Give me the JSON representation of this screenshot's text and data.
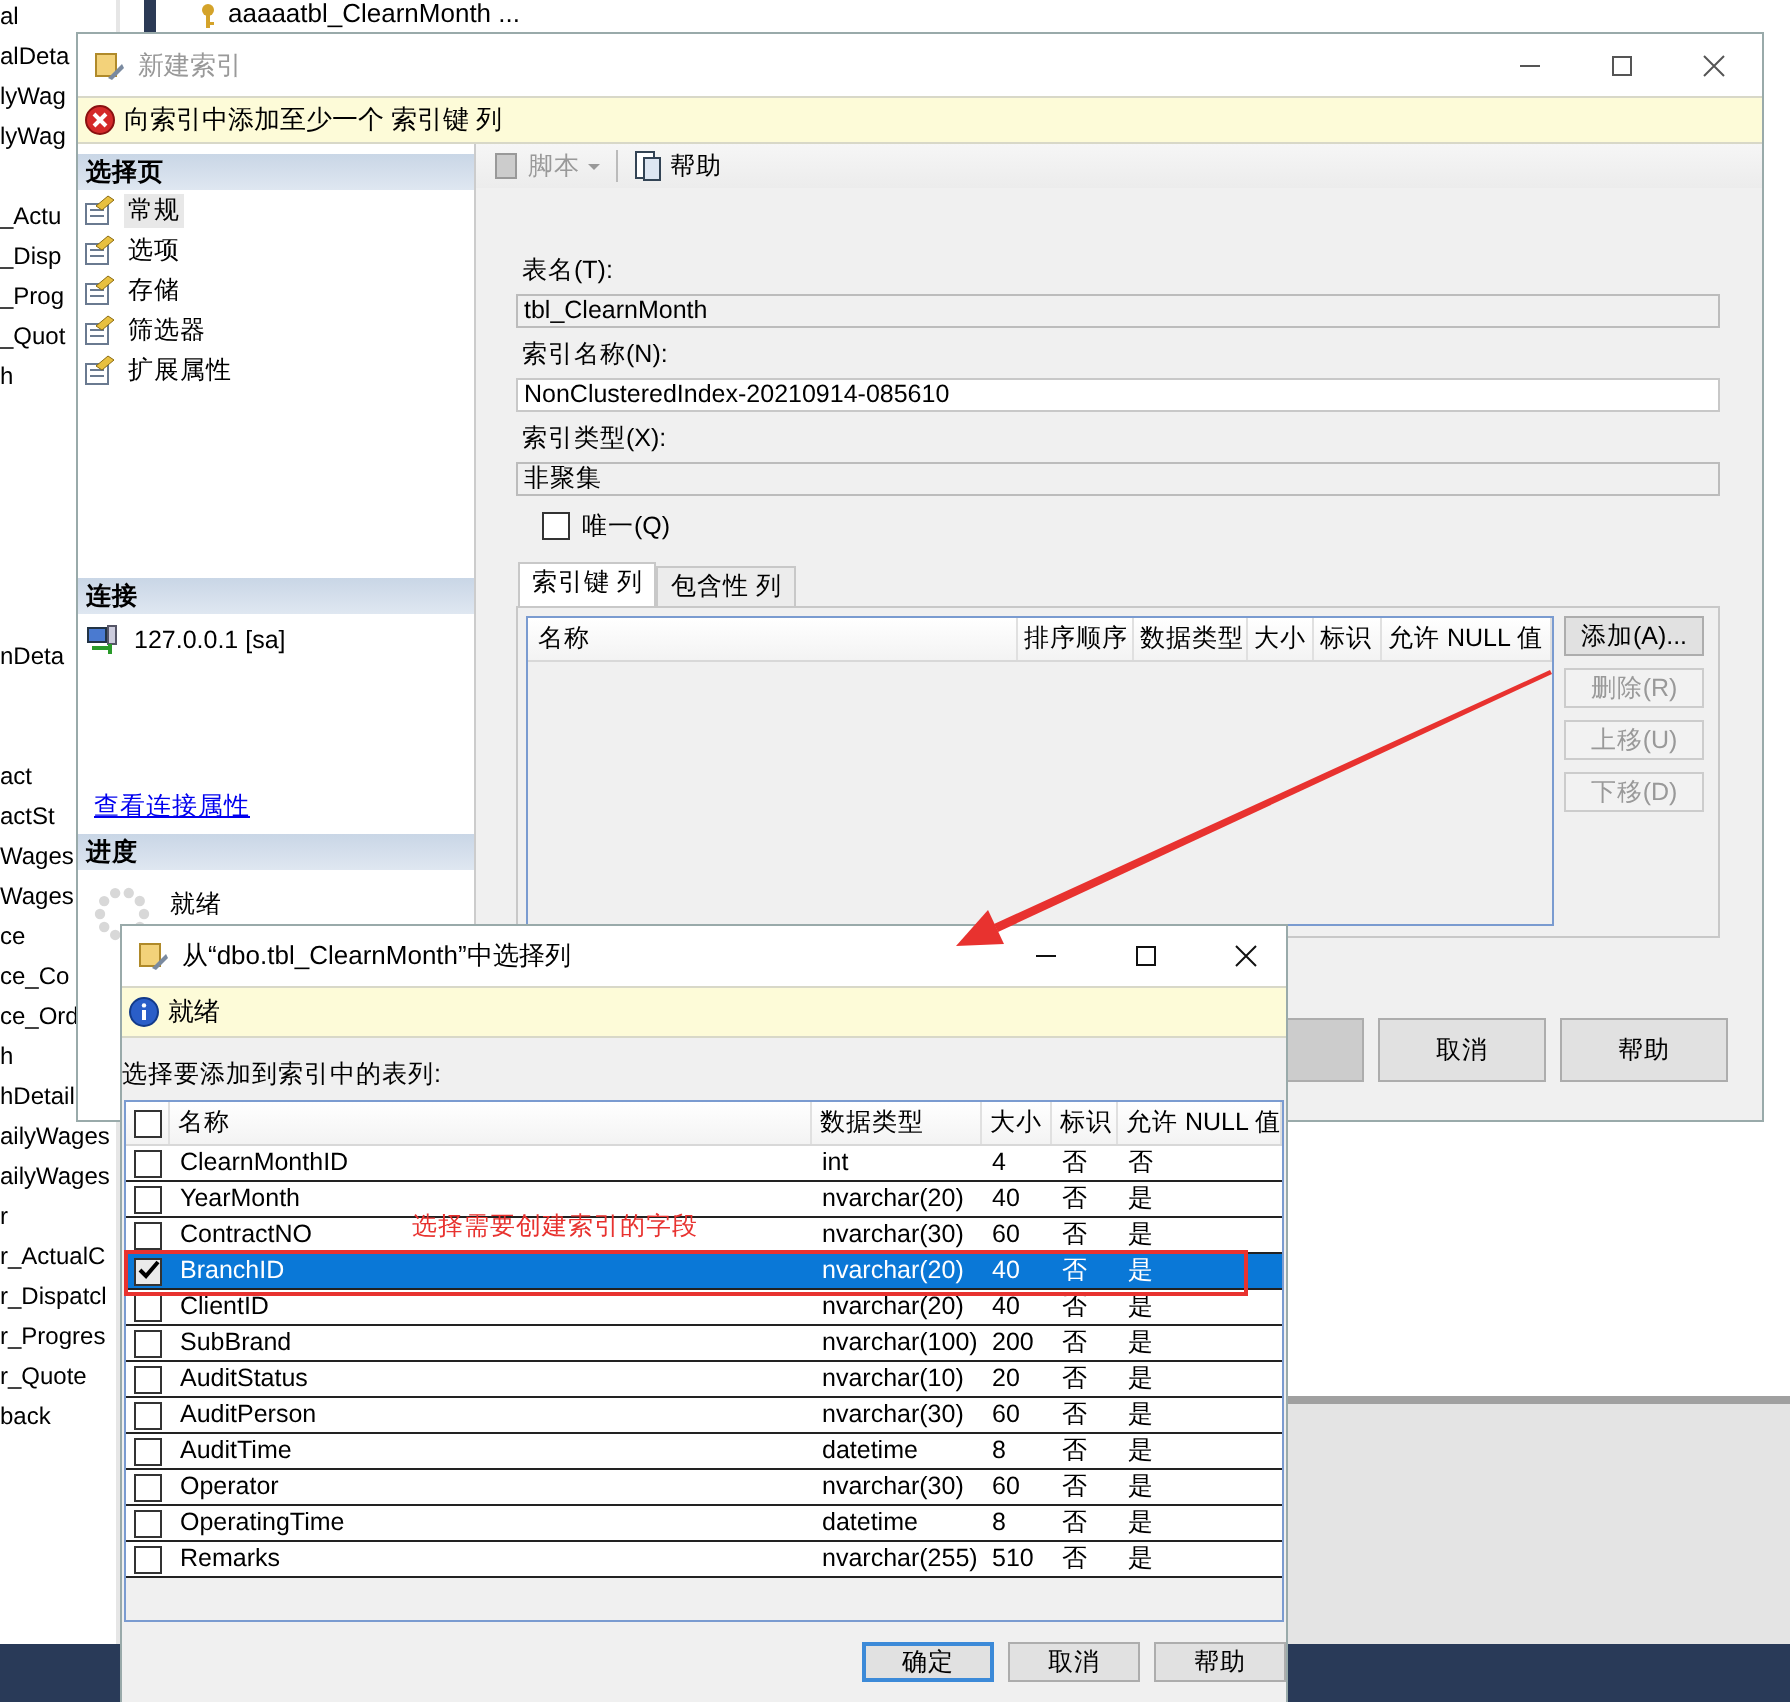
{
  "explorer": {
    "tab": {
      "title": "aaaaatbl_ClearnMonth ..."
    },
    "items": [
      "al",
      "alDeta",
      "lyWag",
      "lyWag",
      "_Actu",
      "_Disp",
      "_Prog",
      "_Quot",
      "h",
      "nDeta",
      "act",
      "actSt",
      "Wages",
      "Wages",
      "ce",
      "ce_Co",
      "ce_Ord",
      "h",
      "hDetail",
      "ailyWages",
      "ailyWages",
      "r",
      "r_ActualC",
      "r_Dispatcl",
      "r_Progres",
      "r_Quote",
      "back"
    ]
  },
  "index_dialog": {
    "title": "新建索引",
    "error_banner": "向索引中添加至少一个 索引键 列",
    "pages": {
      "header": "选择页",
      "items": [
        {
          "label": "常规",
          "selected": true
        },
        {
          "label": "选项",
          "selected": false
        },
        {
          "label": "存储",
          "selected": false
        },
        {
          "label": "筛选器",
          "selected": false
        },
        {
          "label": "扩展属性",
          "selected": false
        }
      ]
    },
    "connection": {
      "header": "连接",
      "server": "127.0.0.1 [sa]",
      "link": "查看连接属性"
    },
    "progress": {
      "header": "进度",
      "status": "就绪"
    },
    "toolbar": [
      {
        "kind": "dropdown",
        "label": "脚本",
        "disabled": true
      },
      {
        "kind": "button",
        "label": "帮助",
        "disabled": false
      }
    ],
    "fields": [
      {
        "label": "表名(T):",
        "value": "tbl_ClearnMonth",
        "disabled": true
      },
      {
        "label": "索引名称(N):",
        "value": "NonClusteredIndex-20210914-085610",
        "disabled": false
      },
      {
        "label": "索引类型(X):",
        "value": "非聚集",
        "disabled": true
      }
    ],
    "unique": {
      "label": "唯一(Q)",
      "checked": false
    },
    "tabs": [
      {
        "label": "索引键 列",
        "selected": true
      },
      {
        "label": "包含性 列",
        "selected": false
      }
    ],
    "grid_columns": [
      "名称",
      "排序顺序",
      "数据类型",
      "大小",
      "标识",
      "允许 NULL 值"
    ],
    "side_buttons": [
      {
        "label": "添加(A)...",
        "disabled": false
      },
      {
        "label": "删除(R)",
        "disabled": true
      },
      {
        "label": "上移(U)",
        "disabled": true
      },
      {
        "label": "下移(D)",
        "disabled": true
      }
    ],
    "footer_buttons": [
      "取消",
      "帮助"
    ]
  },
  "column_picker": {
    "title": "从“dbo.tbl_ClearnMonth”中选择列",
    "info_banner": "就绪",
    "prompt": "选择要添加到索引中的表列:",
    "select_all": false,
    "columns": [
      "名称",
      "数据类型",
      "大小",
      "标识",
      "允许 NULL 值"
    ],
    "rows": [
      {
        "name": "ClearnMonthID",
        "type": "int",
        "size": "4",
        "identity": "否",
        "nullable": "否",
        "checked": false,
        "selected": false
      },
      {
        "name": "YearMonth",
        "type": "nvarchar(20)",
        "size": "40",
        "identity": "否",
        "nullable": "是",
        "checked": false,
        "selected": false
      },
      {
        "name": "ContractNO",
        "type": "nvarchar(30)",
        "size": "60",
        "identity": "否",
        "nullable": "是",
        "checked": false,
        "selected": false
      },
      {
        "name": "BranchID",
        "type": "nvarchar(20)",
        "size": "40",
        "identity": "否",
        "nullable": "是",
        "checked": true,
        "selected": true
      },
      {
        "name": "ClientID",
        "type": "nvarchar(20)",
        "size": "40",
        "identity": "否",
        "nullable": "是",
        "checked": false,
        "selected": false
      },
      {
        "name": "SubBrand",
        "type": "nvarchar(100)",
        "size": "200",
        "identity": "否",
        "nullable": "是",
        "checked": false,
        "selected": false
      },
      {
        "name": "AuditStatus",
        "type": "nvarchar(10)",
        "size": "20",
        "identity": "否",
        "nullable": "是",
        "checked": false,
        "selected": false
      },
      {
        "name": "AuditPerson",
        "type": "nvarchar(30)",
        "size": "60",
        "identity": "否",
        "nullable": "是",
        "checked": false,
        "selected": false
      },
      {
        "name": "AuditTime",
        "type": "datetime",
        "size": "8",
        "identity": "否",
        "nullable": "是",
        "checked": false,
        "selected": false
      },
      {
        "name": "Operator",
        "type": "nvarchar(30)",
        "size": "60",
        "identity": "否",
        "nullable": "是",
        "checked": false,
        "selected": false
      },
      {
        "name": "OperatingTime",
        "type": "datetime",
        "size": "8",
        "identity": "否",
        "nullable": "是",
        "checked": false,
        "selected": false
      },
      {
        "name": "Remarks",
        "type": "nvarchar(255)",
        "size": "510",
        "identity": "否",
        "nullable": "是",
        "checked": false,
        "selected": false
      }
    ],
    "buttons": [
      {
        "label": "确定",
        "default": true
      },
      {
        "label": "取消",
        "default": false
      },
      {
        "label": "帮助",
        "default": false
      }
    ]
  },
  "annotation": {
    "callout": "选择需要创建索引的字段"
  }
}
